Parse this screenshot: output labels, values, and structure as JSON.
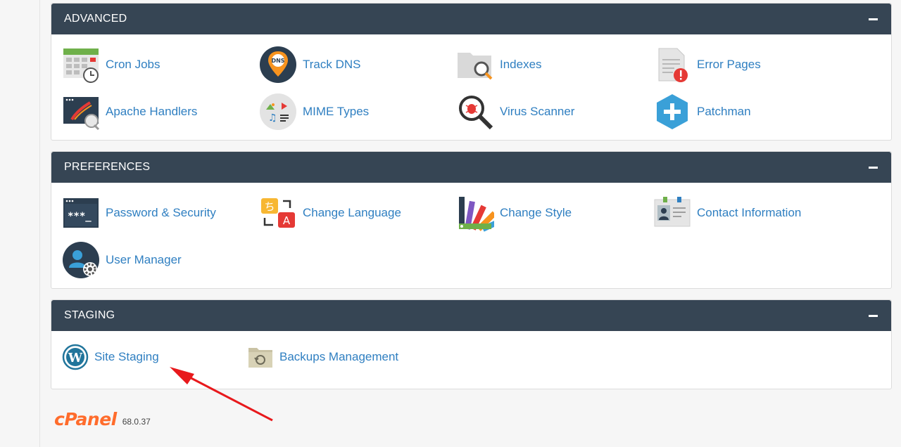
{
  "sections": {
    "advanced": {
      "title": "ADVANCED",
      "items": [
        {
          "label": "Cron Jobs",
          "icon": "calendar-clock-icon"
        },
        {
          "label": "Track DNS",
          "icon": "dns-pin-icon"
        },
        {
          "label": "Indexes",
          "icon": "folder-search-icon"
        },
        {
          "label": "Error Pages",
          "icon": "document-error-icon"
        },
        {
          "label": "Apache Handlers",
          "icon": "apache-handlers-icon"
        },
        {
          "label": "MIME Types",
          "icon": "mime-types-icon"
        },
        {
          "label": "Virus Scanner",
          "icon": "virus-scanner-icon"
        },
        {
          "label": "Patchman",
          "icon": "patchman-icon"
        }
      ]
    },
    "preferences": {
      "title": "PREFERENCES",
      "items": [
        {
          "label": "Password & Security",
          "icon": "password-icon"
        },
        {
          "label": "Change Language",
          "icon": "language-icon"
        },
        {
          "label": "Change Style",
          "icon": "style-palette-icon"
        },
        {
          "label": "Contact Information",
          "icon": "contact-card-icon"
        },
        {
          "label": "User Manager",
          "icon": "user-manager-icon"
        }
      ]
    },
    "staging": {
      "title": "STAGING",
      "items": [
        {
          "label": "Site Staging",
          "icon": "wordpress-icon"
        },
        {
          "label": "Backups Management",
          "icon": "backup-folder-icon"
        }
      ]
    }
  },
  "footer": {
    "brand": "cPanel",
    "version": "68.0.37"
  },
  "colors": {
    "header": "#364554",
    "link": "#2f7fc1",
    "brand": "#ff6c2c",
    "annotation_arrow": "#e8191c"
  }
}
